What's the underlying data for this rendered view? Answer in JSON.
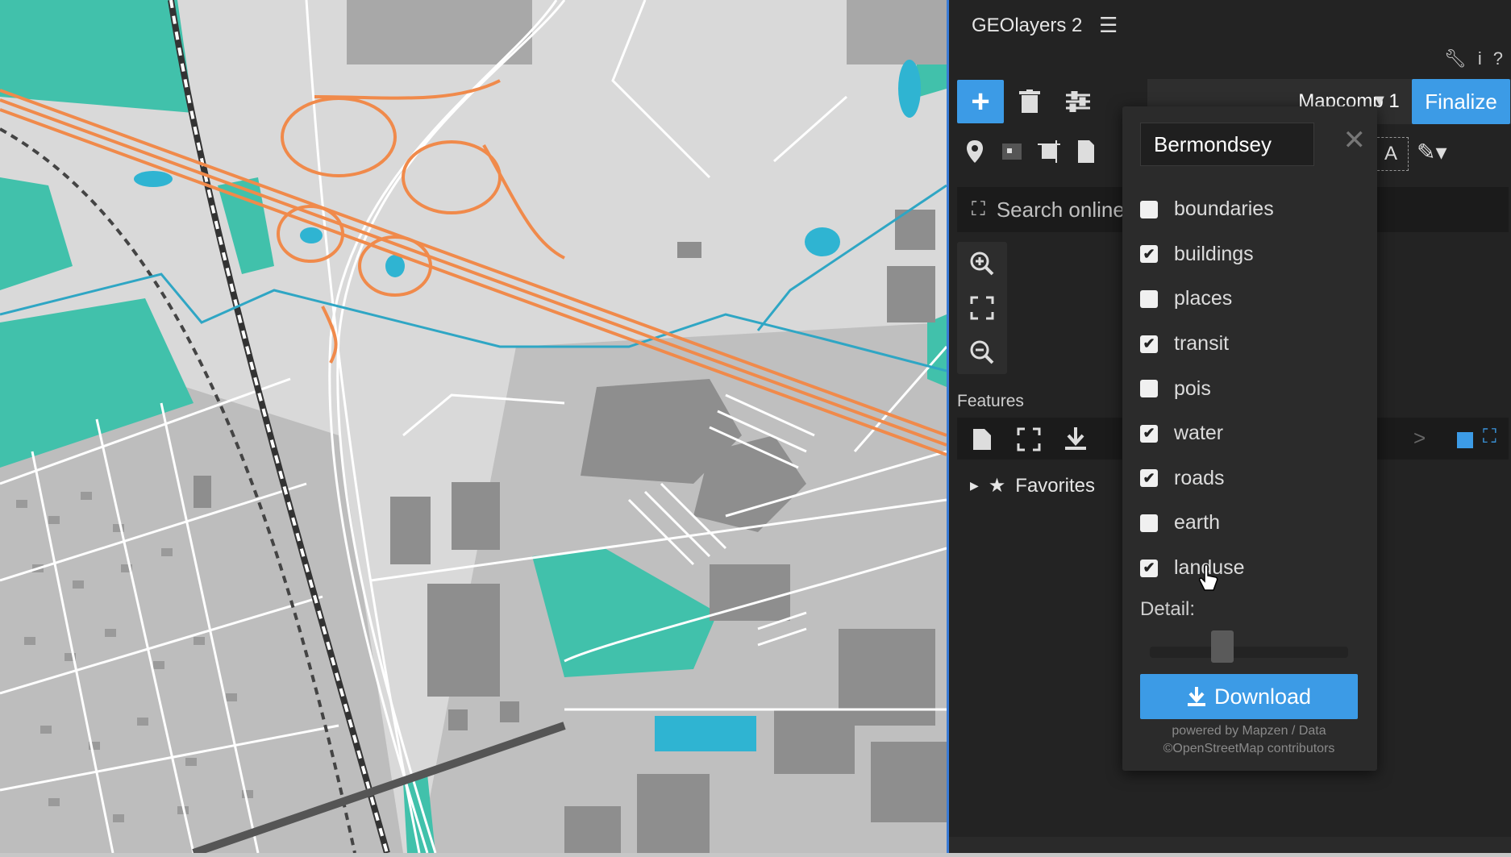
{
  "app": {
    "title": "GEOlayers 2",
    "menu_icon": "hamburger-icon"
  },
  "toolbar": {
    "add_icon": "plus-icon",
    "delete_icon": "trash-icon",
    "settings_icon": "sliders-icon",
    "composition_select": "Mapcomp 1",
    "finalize_label": "Finalize",
    "utility_icons": [
      "wrench-icon",
      "info-icon",
      "help-icon"
    ]
  },
  "search": {
    "placeholder": "Search online"
  },
  "features": {
    "label": "Features",
    "favorites_label": "Favorites"
  },
  "popup": {
    "location_value": "Bermondsey",
    "layers": [
      {
        "label": "boundaries",
        "checked": false
      },
      {
        "label": "buildings",
        "checked": true
      },
      {
        "label": "places",
        "checked": false
      },
      {
        "label": "transit",
        "checked": true
      },
      {
        "label": "pois",
        "checked": false
      },
      {
        "label": "water",
        "checked": true
      },
      {
        "label": "roads",
        "checked": true
      },
      {
        "label": "earth",
        "checked": false
      },
      {
        "label": "landuse",
        "checked": true
      }
    ],
    "detail_label": "Detail:",
    "detail_level": 0.35,
    "download_label": "Download",
    "attribution_line1": "powered by Mapzen / Data",
    "attribution_line2": "©OpenStreetMap contributors"
  },
  "colors": {
    "accent": "#3c9be6",
    "panel_bg": "#232323",
    "map_green": "#41c1ab",
    "map_orange": "#f08a4b",
    "map_water": "#2fb4d2",
    "map_building": "#8e8e8e",
    "map_land": "#d9d9d9"
  }
}
